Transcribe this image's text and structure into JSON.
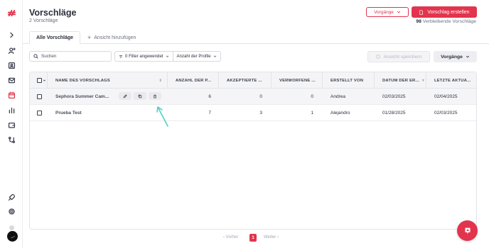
{
  "header": {
    "title": "Vorschläge",
    "subtitle": "2 Vorschläge",
    "processes_button": "Vorgänge",
    "create_button": "Vorschlag erstellen",
    "remaining_count": "98",
    "remaining_label": "Verbleibende Vorschläge"
  },
  "tabs": {
    "active": "Alle Vorschläge",
    "add": "Ansicht hinzufügen"
  },
  "toolbar": {
    "search_placeholder": "Suchen",
    "filter_label": "0 Filter angewendet",
    "profiles_label": "Anzahl der Profile",
    "save_view_label": "Ansicht speichern",
    "processes_label": "Vorgänge"
  },
  "table": {
    "columns": [
      "NAME DES VORSCHLAGS",
      "ANZAHL DER P...",
      "AKZEPTIERTE ...",
      "VERWORFENE ...",
      "ERSTELLT VON",
      "DATUM DER ER...",
      "LETZTE AKTUA..."
    ],
    "rows": [
      {
        "name": "Sephora Summer Cam...",
        "profiles": "6",
        "accepted": "0",
        "rejected": "0",
        "created_by": "Andrea",
        "created_date": "02/03/2025",
        "updated": "02/04/2025"
      },
      {
        "name": "Prueba Test",
        "profiles": "7",
        "accepted": "3",
        "rejected": "1",
        "created_by": "Alejandro",
        "created_date": "01/28/2025",
        "updated": "02/03/2025"
      }
    ]
  },
  "pagination": {
    "prev": "Vorher",
    "current": "1",
    "next": "Weiter"
  },
  "colors": {
    "accent": "#e2344d",
    "annotation": "#4fd1c5"
  }
}
